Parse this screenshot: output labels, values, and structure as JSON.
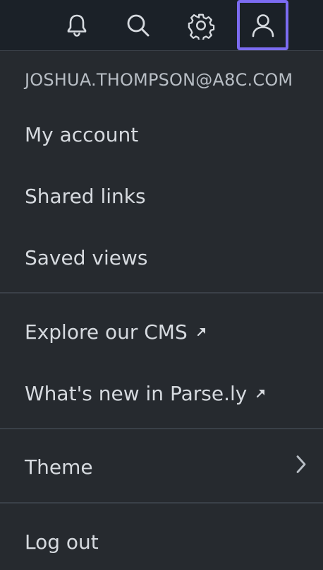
{
  "topbar": {
    "icons": [
      "bell-icon",
      "search-icon",
      "gear-icon",
      "user-icon"
    ],
    "active_color": "#7c6cf2"
  },
  "menu": {
    "email": "JOSHUA.THOMPSON@A8C.COM",
    "items": [
      {
        "label": "My account"
      },
      {
        "label": "Shared links"
      },
      {
        "label": "Saved views"
      },
      {
        "label": "Explore our CMS",
        "icon": "external-link-icon"
      },
      {
        "label": "What's new in Parse.ly",
        "icon": "external-link-icon"
      },
      {
        "label": "Theme",
        "icon": "chevron-right-icon"
      },
      {
        "label": "Log out"
      }
    ]
  },
  "colors": {
    "background": "#262a2f",
    "topbar": "#1b2128",
    "text": "#d6dadf",
    "divider": "#3a4048"
  }
}
